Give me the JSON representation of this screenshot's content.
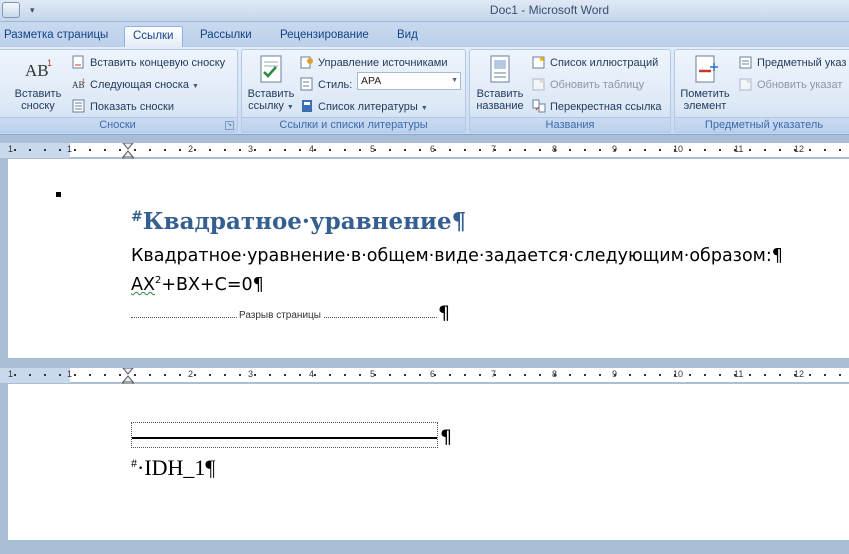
{
  "window": {
    "title": "Doc1 - Microsoft Word"
  },
  "tabs": [
    {
      "label": "Разметка страницы"
    },
    {
      "label": "Ссылки"
    },
    {
      "label": "Рассылки"
    },
    {
      "label": "Рецензирование"
    },
    {
      "label": "Вид"
    }
  ],
  "ribbon": {
    "footnotes": {
      "group_label": "Сноски",
      "insert_footnote": "Вставить\nсноску",
      "insert_endnote": "Вставить концевую сноску",
      "next_footnote": "Следующая сноска",
      "show_notes": "Показать сноски"
    },
    "citations": {
      "group_label": "Ссылки и списки литературы",
      "insert_citation": "Вставить\nссылку",
      "manage_sources": "Управление источниками",
      "style_label": "Стиль:",
      "style_value": "APA",
      "bibliography": "Список литературы"
    },
    "captions": {
      "group_label": "Названия",
      "insert_caption": "Вставить\nназвание",
      "insert_table_of_figures": "Список иллюстраций",
      "update_table": "Обновить таблицу",
      "cross_reference": "Перекрестная ссылка"
    },
    "index": {
      "group_label": "Предметный указатель",
      "mark_entry": "Пометить\nэлемент",
      "insert_index": "Предметный указ",
      "update_index": "Обновить указат"
    }
  },
  "ruler": {
    "numbers": [
      "1",
      "1",
      "2",
      "3",
      "4",
      "5",
      "6",
      "7",
      "8",
      "9",
      "10",
      "11",
      "12"
    ]
  },
  "document": {
    "heading_hash": "#",
    "heading": "Квадратное·уравнение¶",
    "line1": "Квадратное·уравнение·в·общем·виде·задается·следующим·образом:¶",
    "equation_prefix": "AX",
    "equation_sup": "2",
    "equation_suffix": "+BX+C=0¶",
    "page_break_label": "Разрыв страницы",
    "page_break_mark": "¶",
    "hr_mark": "¶",
    "bookmark_hash": "#",
    "bookmark_text": "·IDH_1¶"
  },
  "colors": {
    "heading": "#365f91",
    "ribbon_text": "#15428b"
  }
}
